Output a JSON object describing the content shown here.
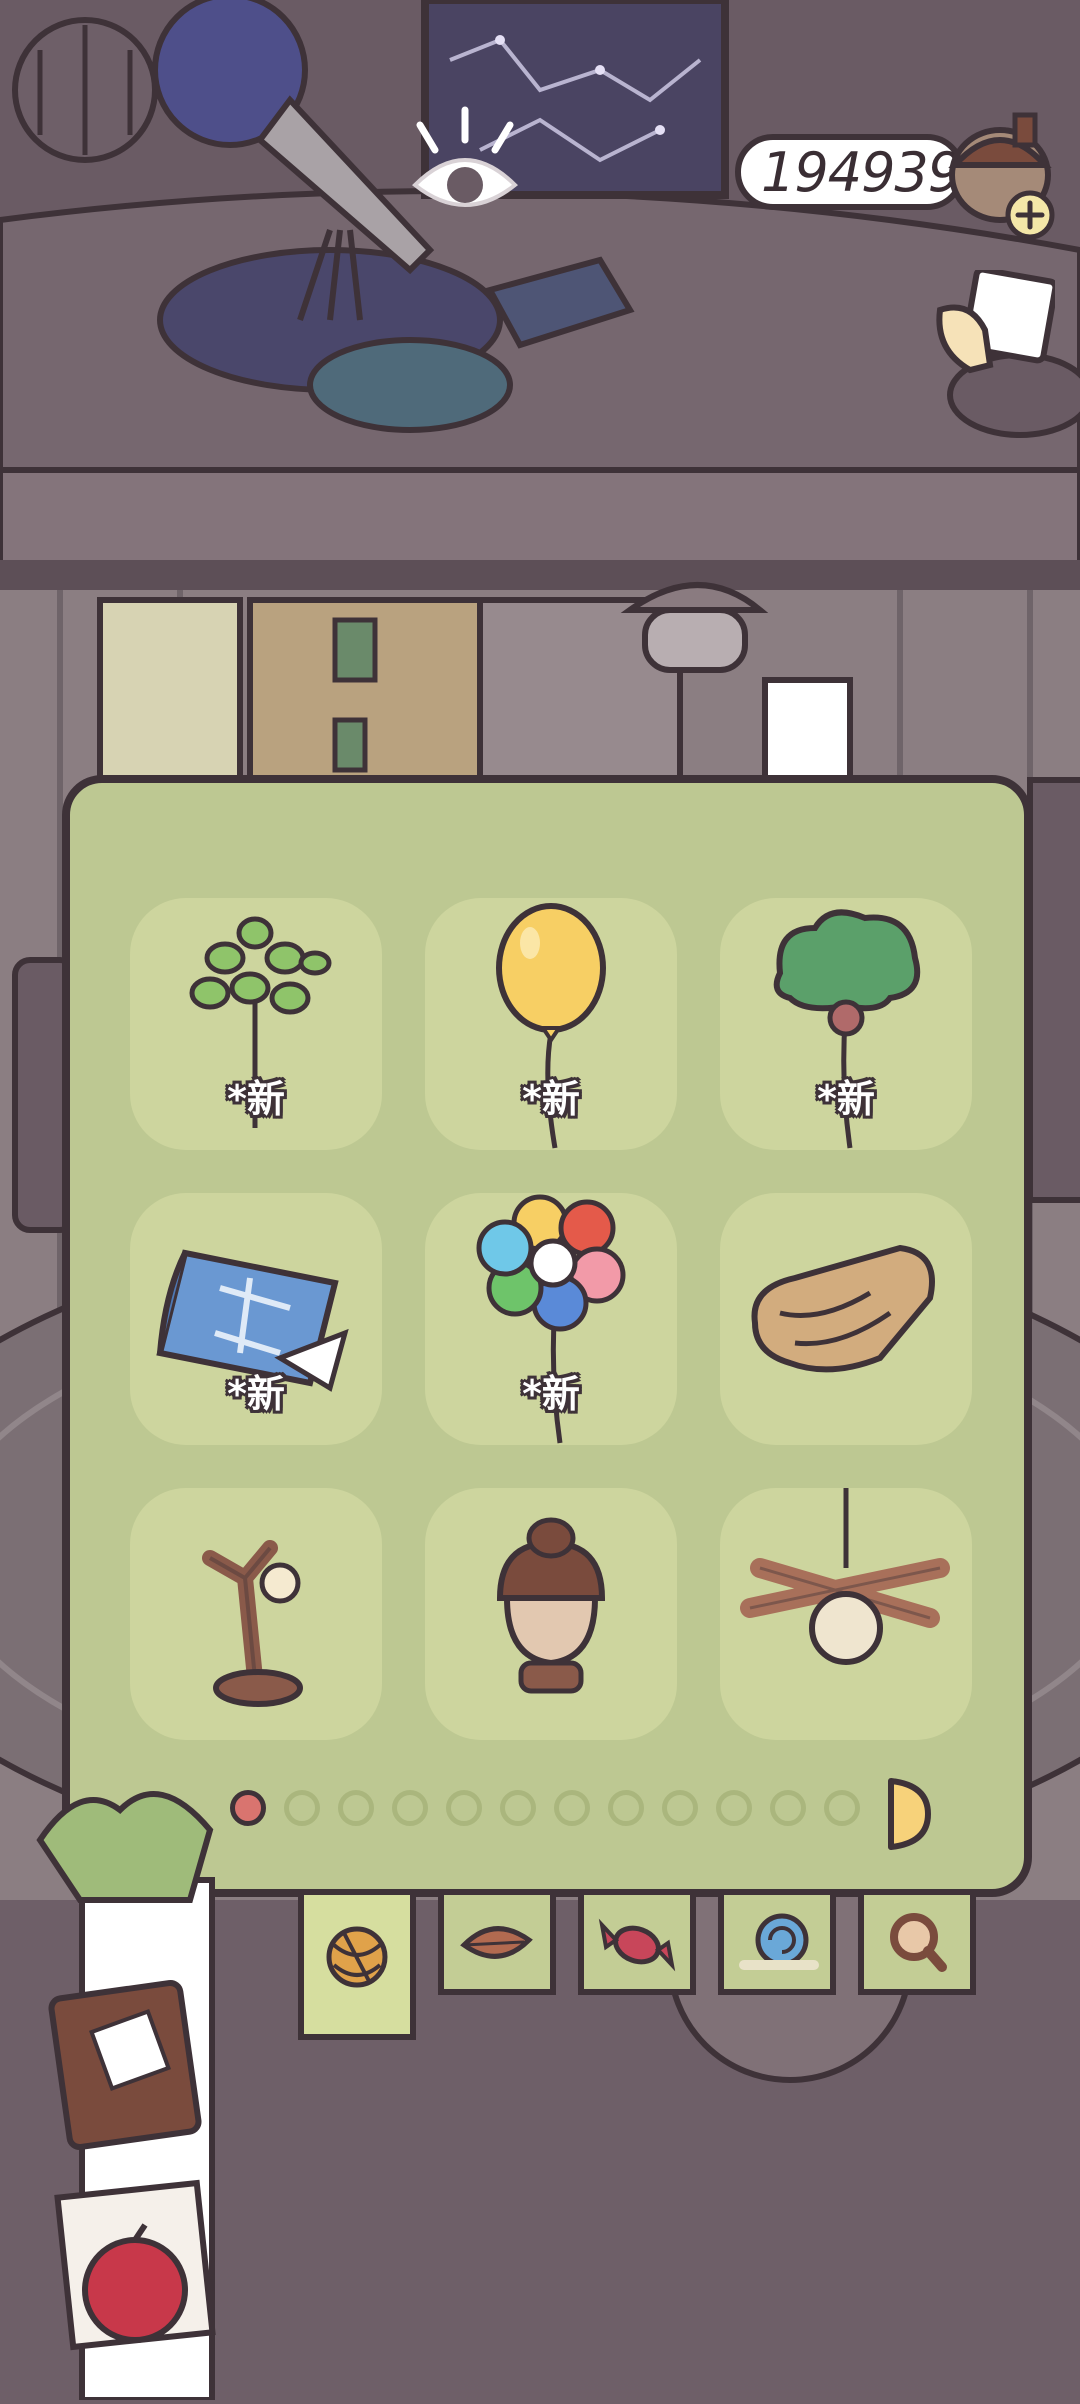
{
  "hud": {
    "currency_value": "194939",
    "currency_icon": "acorn-plus-icon",
    "card_icon": "hand-card-icon",
    "view_icon": "eye-icon"
  },
  "panel": {
    "items": [
      {
        "name": "leaf-branch-balloon",
        "badge": "*新"
      },
      {
        "name": "yellow-balloon",
        "badge": "*新"
      },
      {
        "name": "tree-balloon",
        "badge": "*新"
      },
      {
        "name": "blue-scroll-blueprint",
        "badge": "*新"
      },
      {
        "name": "rainbow-flower-balloon",
        "badge": "*新"
      },
      {
        "name": "brown-blanket",
        "badge": ""
      },
      {
        "name": "branch-lamp",
        "badge": ""
      },
      {
        "name": "acorn-lamp",
        "badge": ""
      },
      {
        "name": "stick-pendant-lamp",
        "badge": ""
      }
    ],
    "page_count": 12,
    "current_page": 1
  },
  "tabs": [
    {
      "icon": "yarn-ball-icon",
      "active": true
    },
    {
      "icon": "leaf-icon",
      "active": false
    },
    {
      "icon": "candy-icon",
      "active": false
    },
    {
      "icon": "snail-shell-icon",
      "active": false
    },
    {
      "icon": "magnifier-icon",
      "active": false
    }
  ],
  "colors": {
    "background": "#6f5f68",
    "panel": "#bdc892",
    "slot": "#cdd59e",
    "outline": "#3e3238",
    "active_dot": "#d9746f"
  }
}
